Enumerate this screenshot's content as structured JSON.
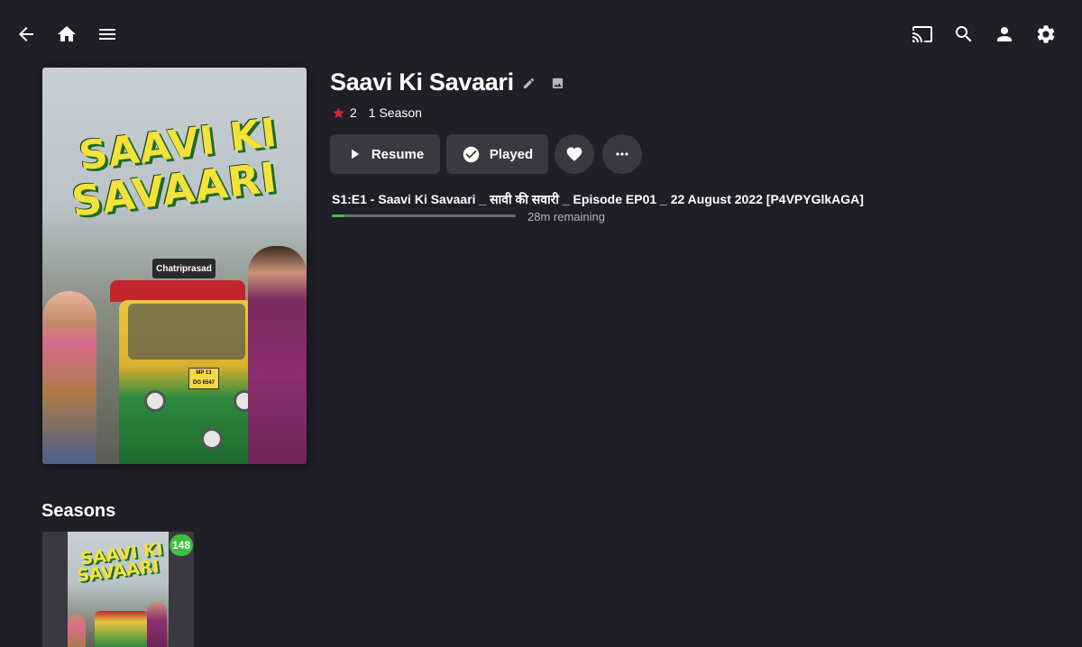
{
  "nav": {
    "back_icon": "arrow-left",
    "home_icon": "home",
    "menu_icon": "hamburger-menu",
    "cast_icon": "cast",
    "search_icon": "search",
    "user_icon": "person",
    "settings_icon": "gear"
  },
  "poster": {
    "logo_line1": "SAAVI KI",
    "logo_line2": "SAVAARI",
    "board_text": "Chatriprasad",
    "plate_line1": "MP 13",
    "plate_line2": "DG 6547"
  },
  "item": {
    "title": "Saavi Ki Savaari",
    "rating": "2",
    "season_count": "1 Season"
  },
  "actions": {
    "resume_label": "Resume",
    "played_label": "Played"
  },
  "next_up": {
    "episode_title": "S1:E1 - Saavi Ki Savaari _ सावी की सवारी _ Episode EP01 _ 22 August 2022 [P4VPYGlkAGA]",
    "progress_fraction": 0.07,
    "remaining": "28m remaining"
  },
  "seasons": {
    "heading": "Seasons",
    "cards": [
      {
        "badge": "148",
        "logo_line1": "SAAVI KI",
        "logo_line2": "SAVAARI"
      }
    ]
  },
  "colors": {
    "background": "#201e26",
    "button_bg": "#3a3840",
    "accent_green": "#3fbf3f",
    "star_red": "#d3242c"
  }
}
